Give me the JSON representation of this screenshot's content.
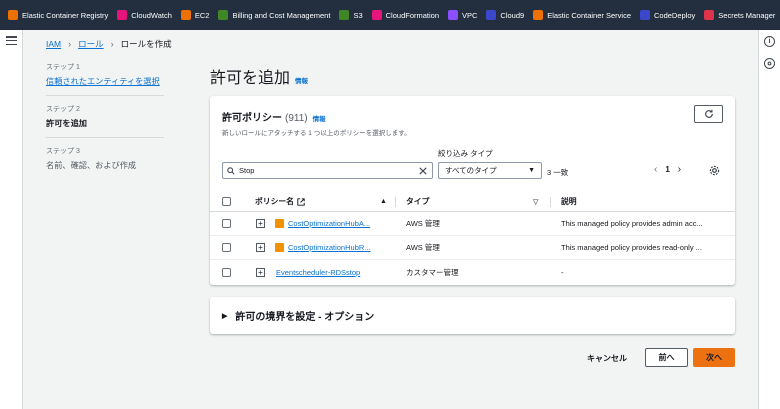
{
  "favorites": [
    {
      "label": "Elastic Container Registry",
      "color": "#ed7100",
      "icon": "ecr-icon"
    },
    {
      "label": "CloudWatch",
      "color": "#e7157b",
      "icon": "cloudwatch-icon"
    },
    {
      "label": "EC2",
      "color": "#ed7100",
      "icon": "ec2-icon"
    },
    {
      "label": "Billing and Cost Management",
      "color": "#3f8624",
      "icon": "billing-icon"
    },
    {
      "label": "S3",
      "color": "#3f8624",
      "icon": "s3-icon"
    },
    {
      "label": "CloudFormation",
      "color": "#e7157b",
      "icon": "cloudformation-icon"
    },
    {
      "label": "VPC",
      "color": "#8c4fff",
      "icon": "vpc-icon"
    },
    {
      "label": "Cloud9",
      "color": "#3b48cc",
      "icon": "cloud9-icon"
    },
    {
      "label": "Elastic Container Service",
      "color": "#ed7100",
      "icon": "ecs-icon"
    },
    {
      "label": "CodeDeploy",
      "color": "#3b48cc",
      "icon": "codedeploy-icon"
    },
    {
      "label": "Secrets Manager",
      "color": "#dd344c",
      "icon": "secrets-manager-icon"
    }
  ],
  "breadcrumb": {
    "iam": "IAM",
    "roles": "ロール",
    "current": "ロールを作成"
  },
  "steps": [
    {
      "num": "ステップ 1",
      "label": "信頼されたエンティティを選択"
    },
    {
      "num": "ステップ 2",
      "label": "許可を追加"
    },
    {
      "num": "ステップ 3",
      "label": "名前、確認、および作成"
    }
  ],
  "page": {
    "title": "許可を追加",
    "info": "情報"
  },
  "policies": {
    "title": "許可ポリシー",
    "count": "(911)",
    "info": "情報",
    "description": "新しいロールにアタッチする 1 つ以上のポリシーを選択します。",
    "filter_label": "絞り込み タイプ",
    "search_value": "Stop",
    "filter_value": "すべてのタイプ",
    "match_count": "3 一致",
    "page": "1",
    "columns": {
      "name": "ポリシー名",
      "type": "タイプ",
      "description": "説明"
    },
    "rows": [
      {
        "name": "CostOptimizationHubA...",
        "type": "AWS 管理",
        "description": "This managed policy provides admin acc...",
        "aws_icon": true
      },
      {
        "name": "CostOptimizationHubR...",
        "type": "AWS 管理",
        "description": "This managed policy provides read-only ...",
        "aws_icon": true
      },
      {
        "name": "Eventscheduler-RDSstop",
        "type": "カスタマー管理",
        "description": "-",
        "aws_icon": false
      }
    ]
  },
  "boundary": {
    "label": "許可の境界を設定 - オプション"
  },
  "footer": {
    "cancel": "キャンセル",
    "prev": "前へ",
    "next": "次へ"
  },
  "colors": {
    "accent": "#ec7211",
    "link": "#0972d3",
    "topbar": "#232f3e"
  }
}
